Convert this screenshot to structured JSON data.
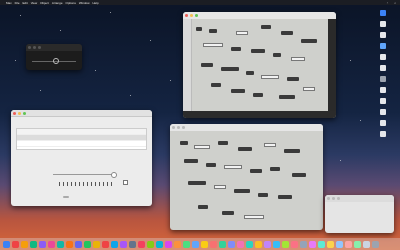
{
  "menubar": {
    "items": [
      "",
      "Max",
      "File",
      "Edit",
      "View",
      "Object",
      "Arrange",
      "Options",
      "Window",
      "Help"
    ],
    "clock": ""
  },
  "windows": {
    "patcher_top": {
      "title": ""
    },
    "patcher_bottom": {
      "title": ""
    },
    "mini": {
      "title": ""
    },
    "prefs": {
      "title": "",
      "rows": [
        "",
        "",
        ""
      ],
      "slider_label": "",
      "check_label": "",
      "button_label": ""
    },
    "blank": {
      "title": ""
    }
  },
  "dock": {
    "item_colors": [
      "#3b82f6",
      "#ef4444",
      "#f59e0b",
      "#10b981",
      "#8b5cf6",
      "#ec4899",
      "#14b8a6",
      "#f97316",
      "#6366f1",
      "#22c55e",
      "#eab308",
      "#ef4444",
      "#0ea5e9",
      "#a855f7",
      "#64748b",
      "#f43f5e",
      "#84cc16",
      "#06b6d4",
      "#d946ef",
      "#fb923c",
      "#4ade80",
      "#60a5fa",
      "#facc15",
      "#f87171",
      "#34d399",
      "#818cf8",
      "#f472b6",
      "#2dd4bf",
      "#fbbf24",
      "#c084fc",
      "#38bdf8",
      "#a3e635",
      "#fb7185",
      "#94a3b8",
      "#e879f9",
      "#5eead4",
      "#fcd34d",
      "#93c5fd",
      "#fca5a5",
      "#86efac",
      "#cbd5e1",
      "#9ca3af"
    ]
  },
  "desktop_icon_colors": [
    "#3b82f6",
    "#e5e7eb",
    "#e5e7eb",
    "#60a5fa",
    "#e5e7eb",
    "#e5e7eb",
    "#9ca3af",
    "#e5e7eb",
    "#e5e7eb",
    "#e5e7eb",
    "#e5e7eb",
    "#e5e7eb"
  ]
}
